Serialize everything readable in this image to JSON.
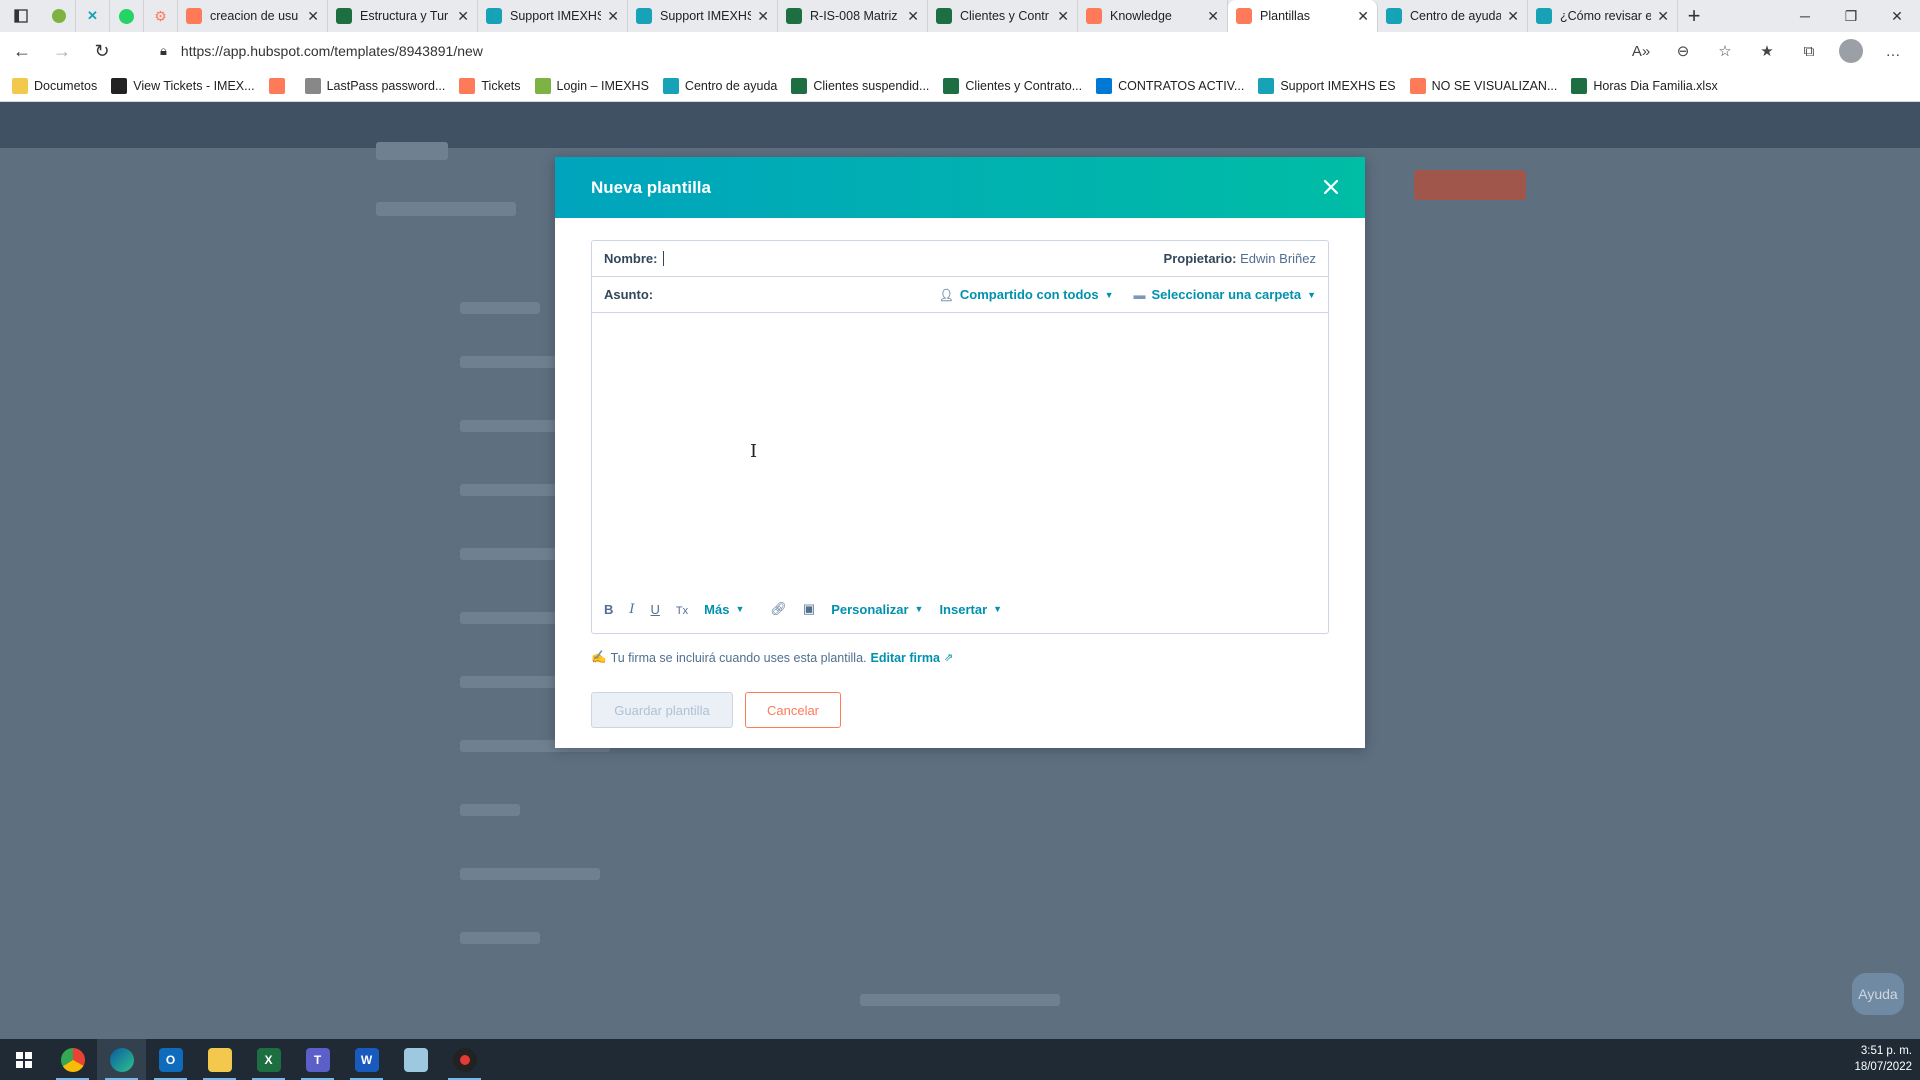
{
  "browser": {
    "tabs": [
      {
        "label": "creacion de usu",
        "icon": "hubspot-icon",
        "color": "#ff7a59"
      },
      {
        "label": "Estructura y Tur",
        "icon": "excel-icon",
        "color": "#1d6f42"
      },
      {
        "label": "Support IMEXHS",
        "icon": "imexhs-icon",
        "color": "#17a2b8"
      },
      {
        "label": "Support IMEXHS",
        "icon": "imexhs-icon",
        "color": "#17a2b8"
      },
      {
        "label": "R-IS-008 Matriz",
        "icon": "excel-icon",
        "color": "#1d6f42"
      },
      {
        "label": "Clientes y Contr",
        "icon": "excel-icon",
        "color": "#1d6f42"
      },
      {
        "label": "Knowledge",
        "icon": "hubspot-icon",
        "color": "#ff7a59"
      },
      {
        "label": "Plantillas",
        "icon": "hubspot-icon",
        "color": "#ff7a59",
        "active": true
      },
      {
        "label": "Centro de ayuda",
        "icon": "imexhs-icon",
        "color": "#17a2b8"
      },
      {
        "label": "¿Cómo revisar e",
        "icon": "imexhs-icon",
        "color": "#17a2b8"
      }
    ],
    "url": "https://app.hubspot.com/templates/8943891/new",
    "bookmarks": [
      {
        "label": "Documetos",
        "icon": "folder-icon",
        "color": "#f2c94c"
      },
      {
        "label": "View Tickets - IMEX...",
        "icon": "x-icon",
        "color": "#222222"
      },
      {
        "label": "",
        "icon": "hubspot-icon",
        "color": "#ff7a59"
      },
      {
        "label": "LastPass password...",
        "icon": "document-icon",
        "color": "#888888"
      },
      {
        "label": "Tickets",
        "icon": "hubspot-icon",
        "color": "#ff7a59"
      },
      {
        "label": "Login – IMEXHS",
        "icon": "imexhs-icon",
        "color": "#7cb342"
      },
      {
        "label": "Centro de ayuda",
        "icon": "imexhs-icon",
        "color": "#17a2b8"
      },
      {
        "label": "Clientes suspendid...",
        "icon": "excel-icon",
        "color": "#1d6f42"
      },
      {
        "label": "Clientes y Contrato...",
        "icon": "excel-icon",
        "color": "#1d6f42"
      },
      {
        "label": "CONTRATOS ACTIV...",
        "icon": "onedrive-icon",
        "color": "#0078d4"
      },
      {
        "label": "Support IMEXHS ES",
        "icon": "imexhs-icon",
        "color": "#17a2b8"
      },
      {
        "label": "NO SE VISUALIZAN...",
        "icon": "hubspot-icon",
        "color": "#ff7a59"
      },
      {
        "label": "Horas Dia Familia.xlsx",
        "icon": "excel-icon",
        "color": "#1d6f42"
      }
    ]
  },
  "modal": {
    "title": "Nueva plantilla",
    "name_label": "Nombre:",
    "owner_label": "Propietario:",
    "owner_value": "Edwin Briñez",
    "subject_label": "Asunto:",
    "shared_label": "Compartido con todos",
    "folder_label": "Seleccionar una carpeta",
    "toolbar": {
      "bold": "B",
      "italic": "I",
      "underline": "U",
      "clear": "Tx",
      "more": "Más",
      "personalize": "Personalizar",
      "insert": "Insertar"
    },
    "signature_text": "Tu firma se incluirá cuando uses esta plantilla.",
    "edit_signature": "Editar firma",
    "save_button": "Guardar plantilla",
    "cancel_button": "Cancelar"
  },
  "page": {
    "help_button": "Ayuda"
  },
  "taskbar": {
    "time": "3:51 p. m.",
    "date": "18/07/2022"
  },
  "colors": {
    "modal_header_start": "#00a4bd",
    "modal_header_end": "#00bda5",
    "link": "#0091ae",
    "cancel": "#ff7a59"
  }
}
